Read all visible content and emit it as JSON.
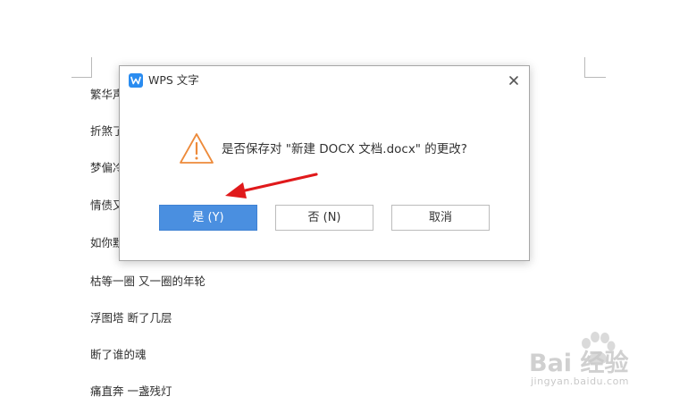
{
  "document": {
    "lines": [
      "繁华声",
      "折煞了",
      "梦偏冷",
      "情债又",
      "如你默",
      "枯等一圈 又一圈的年轮",
      "浮图塔 断了几层",
      "断了谁的魂",
      "痛直奔 一盏残灯"
    ]
  },
  "dialog": {
    "app_icon": "wps-writer-icon",
    "title": "WPS 文字",
    "close_icon": "close-icon",
    "warning_icon": "warning-triangle-icon",
    "message": "是否保存对 \"新建 DOCX 文档.docx\" 的更改?",
    "buttons": {
      "yes": "是 (Y)",
      "no": "否 (N)",
      "cancel": "取消"
    }
  },
  "annotation": {
    "arrow_color": "#e0191b"
  },
  "watermark": {
    "brand": "Bai 经验",
    "url": "jingyan.baidu.com"
  },
  "colors": {
    "primary_button": "#4a8fe0",
    "warning": "#ed8a3a",
    "app_icon": "#2a8cf0"
  }
}
